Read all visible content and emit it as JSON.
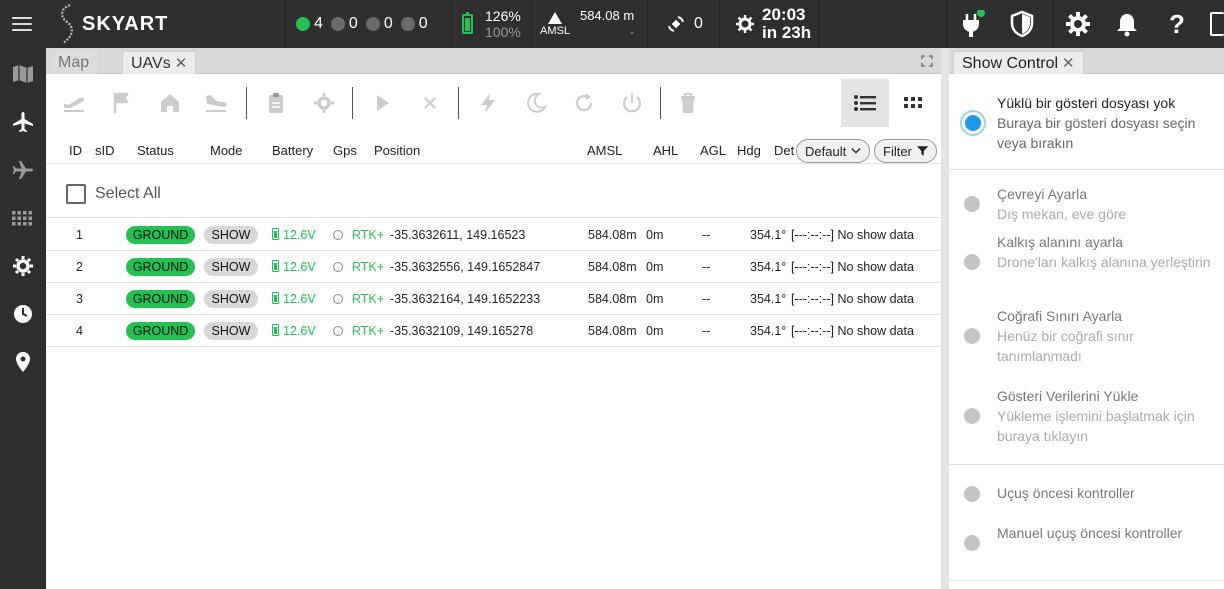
{
  "brand": {
    "name": "SKYART"
  },
  "topbar": {
    "uav_status": [
      {
        "color": "#23c154",
        "count": "4"
      },
      {
        "color": "#6b6b6b",
        "count": "0"
      },
      {
        "color": "#6b6b6b",
        "count": "0"
      },
      {
        "color": "#6b6b6b",
        "count": "0"
      }
    ],
    "battery": {
      "percent": "126%",
      "sub": "100%"
    },
    "altitude": {
      "value": "584.08 m",
      "label": "AMSL",
      "sub": "-"
    },
    "rtk": {
      "count": "0"
    },
    "clock": {
      "time": "20:03",
      "relative": "in 23h"
    }
  },
  "tabs": {
    "map": "Map",
    "uavs": "UAVs"
  },
  "table": {
    "headers": {
      "id": "ID",
      "sid": "sID",
      "status": "Status",
      "mode": "Mode",
      "battery": "Battery",
      "gps": "Gps",
      "position": "Position",
      "amsl": "AMSL",
      "ahl": "AHL",
      "agl": "AGL",
      "hdg": "Hdg",
      "details": "Det"
    },
    "sort_select": "Default",
    "filter_label": "Filter",
    "select_all": "Select All",
    "rows": [
      {
        "id": "1",
        "status": "GROUND",
        "mode": "SHOW",
        "battery": "12.6V",
        "gps": "RTK+",
        "position": "-35.3632611, 149.16523",
        "amsl": "584.08m",
        "ahl": "0m",
        "agl": "--",
        "hdg": "354.1°",
        "details": "[---:--:--] No show data"
      },
      {
        "id": "2",
        "status": "GROUND",
        "mode": "SHOW",
        "battery": "12.6V",
        "gps": "RTK+",
        "position": "-35.3632556, 149.1652847",
        "amsl": "584.08m",
        "ahl": "0m",
        "agl": "--",
        "hdg": "354.1°",
        "details": "[---:--:--] No show data"
      },
      {
        "id": "3",
        "status": "GROUND",
        "mode": "SHOW",
        "battery": "12.6V",
        "gps": "RTK+",
        "position": "-35.3632164, 149.1652233",
        "amsl": "584.08m",
        "ahl": "0m",
        "agl": "--",
        "hdg": "354.1°",
        "details": "[---:--:--] No show data"
      },
      {
        "id": "4",
        "status": "GROUND",
        "mode": "SHOW",
        "battery": "12.6V",
        "gps": "RTK+",
        "position": "-35.3632109, 149.165278",
        "amsl": "584.08m",
        "ahl": "0m",
        "agl": "--",
        "hdg": "354.1°",
        "details": "[---:--:--] No show data"
      }
    ]
  },
  "show_control": {
    "tab_title": "Show Control",
    "steps": [
      {
        "title": "Yüklü bir gösteri dosyası yok",
        "sub": "Buraya bir gösteri dosyası seçin veya bırakın"
      },
      {
        "title": "Çevreyi Ayarla",
        "sub": "Dış mekan, eve göre"
      },
      {
        "title": "Kalkış alanını ayarla",
        "sub": "Drone'ları kalkış alanına yerleştirin"
      },
      {
        "title": "Coğrafi Sınırı Ayarla",
        "sub": "Henüz bir coğrafi sınır tanımlanmadı"
      },
      {
        "title": "Gösteri Verilerini Yükle",
        "sub": "Yükleme işlemini başlatmak için buraya tıklayın"
      },
      {
        "title": "Uçuş öncesi kontroller"
      },
      {
        "title": "Manuel uçuş öncesi kontroller"
      }
    ]
  },
  "colors": {
    "green": "#23c154",
    "accent_blue": "#1e9be6",
    "dark_bg": "#2f2f2f"
  }
}
